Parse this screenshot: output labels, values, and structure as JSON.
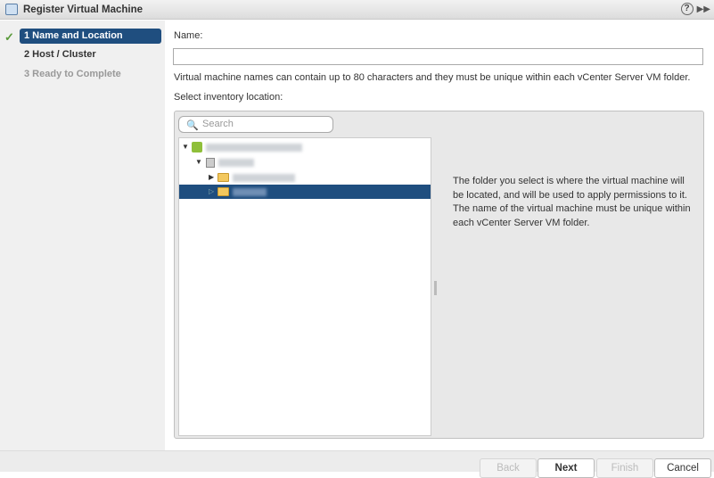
{
  "window": {
    "title": "Register Virtual Machine",
    "help_icon": "?"
  },
  "steps": [
    {
      "label": "1 Name and Location",
      "state": "active-completed"
    },
    {
      "label": "2 Host / Cluster",
      "state": "enabled"
    },
    {
      "label": "3 Ready to Complete",
      "state": "disabled"
    }
  ],
  "form": {
    "name_label": "Name:",
    "name_value": "",
    "name_hint": "Virtual machine names can contain up to 80 characters and they must be unique within each vCenter Server VM folder.",
    "inventory_label": "Select inventory location:",
    "search_placeholder": "Search"
  },
  "info_text": "The folder you select is where the virtual machine will be located, and will be used to apply permissions to it. The name of the virtual machine must be unique within each vCenter Server VM folder.",
  "buttons": {
    "back": "Back",
    "next": "Next",
    "finish": "Finish",
    "cancel": "Cancel"
  }
}
